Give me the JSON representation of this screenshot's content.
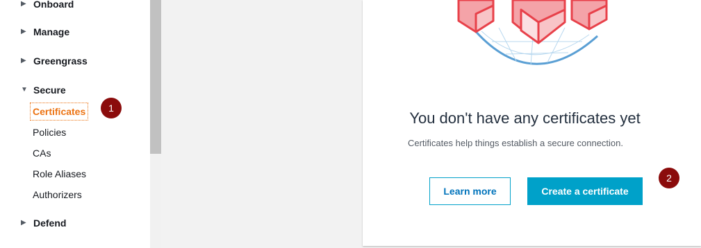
{
  "sidebar": {
    "sections": [
      {
        "label": "Onboard",
        "caret": "▶"
      },
      {
        "label": "Manage",
        "caret": "▶"
      },
      {
        "label": "Greengrass",
        "caret": "▶"
      },
      {
        "label": "Secure",
        "caret": "▼"
      },
      {
        "label": "Defend",
        "caret": "▶"
      }
    ],
    "secure_items": [
      "Certificates",
      "Policies",
      "CAs",
      "Role Aliases",
      "Authorizers"
    ]
  },
  "badges": [
    "1",
    "2"
  ],
  "empty_state": {
    "title": "You don't have any certificates yet",
    "description": "Certificates help things establish a secure connection.",
    "learn_more_label": "Learn more",
    "create_label": "Create a certificate"
  },
  "colors": {
    "active": "#ec7211",
    "primary": "#00a1c9",
    "badge": "#8b0c0c"
  }
}
